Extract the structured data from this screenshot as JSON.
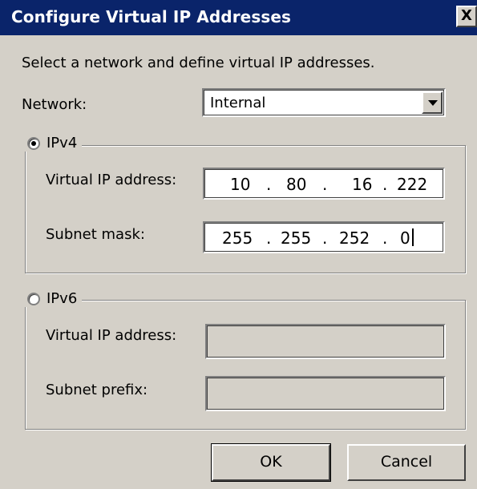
{
  "window": {
    "title": "Configure Virtual IP Addresses",
    "close_glyph": "X"
  },
  "intro_text": "Select a network and define virtual IP addresses.",
  "network": {
    "label": "Network:",
    "selected": "Internal"
  },
  "ipv4": {
    "label": "IPv4",
    "selected": true,
    "virtual_ip_label": "Virtual IP address:",
    "virtual_ip": [
      "10",
      "80",
      "16",
      "222"
    ],
    "subnet_label": "Subnet mask:",
    "subnet_mask": [
      "255",
      "255",
      "252",
      "0"
    ],
    "separator": "."
  },
  "ipv6": {
    "label": "IPv6",
    "selected": false,
    "virtual_ip_label": "Virtual IP address:",
    "subnet_prefix_label": "Subnet prefix:"
  },
  "buttons": {
    "ok": "OK",
    "cancel": "Cancel"
  },
  "colors": {
    "titlebar": "#0a246a",
    "dialog_bg": "#d4d0c8",
    "field_bg": "#ffffff"
  },
  "icons": {
    "close": "close-icon",
    "dropdown": "chevron-down-icon"
  }
}
